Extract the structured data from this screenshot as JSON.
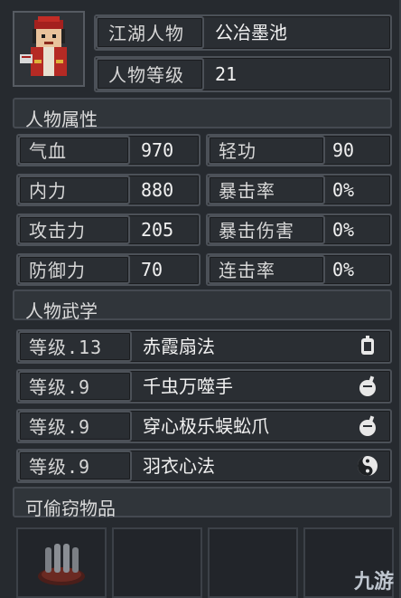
{
  "character": {
    "name_label": "江湖人物",
    "name_value": "公冶墨池",
    "level_label": "人物等级",
    "level_value": "21"
  },
  "attributes_section": {
    "title": "人物属性",
    "rows": [
      {
        "label1": "气血",
        "value1": "970",
        "label2": "轻功",
        "value2": "90"
      },
      {
        "label1": "内力",
        "value1": "880",
        "label2": "暴击率",
        "value2": "0%"
      },
      {
        "label1": "攻击力",
        "value1": "205",
        "label2": "暴击伤害",
        "value2": "0%"
      },
      {
        "label1": "防御力",
        "value1": "70",
        "label2": "连击率",
        "value2": "0%"
      }
    ]
  },
  "martial_section": {
    "title": "人物武学",
    "skills": [
      {
        "level": "等级.13",
        "name": "赤霞扇法",
        "icon": "fan-icon"
      },
      {
        "level": "等级.9",
        "name": "千虫万噬手",
        "icon": "fist-icon"
      },
      {
        "level": "等级.9",
        "name": "穿心极乐蜈蚣爪",
        "icon": "fist-icon"
      },
      {
        "level": "等级.9",
        "name": "羽衣心法",
        "icon": "yin-yang-icon"
      }
    ]
  },
  "steal_section": {
    "title": "可偷窃物品"
  },
  "watermark": "九游"
}
